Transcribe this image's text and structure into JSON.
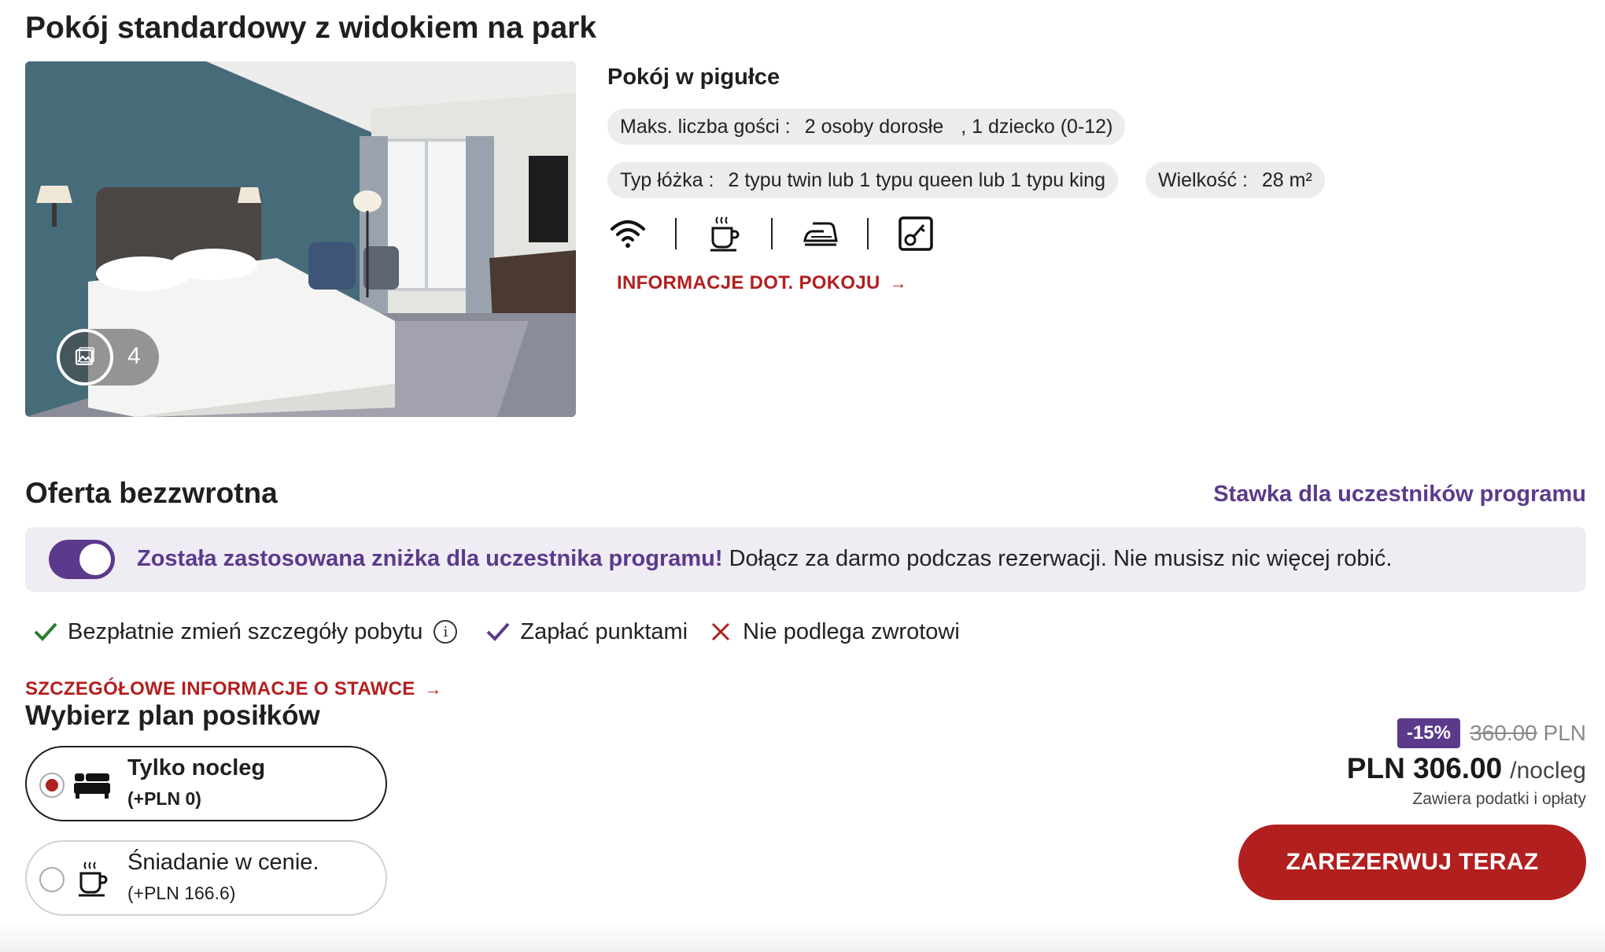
{
  "room": {
    "title": "Pokój standardowy z widokiem na park",
    "gallery_count": "4"
  },
  "summary": {
    "title": "Pokój w pigułce",
    "guests_label": "Maks. liczba gości :",
    "guests_value": "2 osoby dorosłe",
    "guests_child": ", 1 dziecko (0-12)",
    "bed_label": "Typ łóżka :",
    "bed_value": "2 typu twin lub 1 typu queen lub 1 typu king",
    "size_label": "Wielkość :",
    "size_value": "28 m²",
    "amenities": [
      "wifi-icon",
      "coffee-icon",
      "iron-icon",
      "key-card-icon"
    ],
    "info_link": "INFORMACJE DOT. POKOJU"
  },
  "offer": {
    "title": "Oferta bezzwrotna",
    "member_rate_link": "Stawka dla uczestników programu",
    "banner_strong": "Została zastosowana zniżka dla uczestnika programu!",
    "banner_text": " Dołącz za darmo podczas rezerwacji. Nie musisz nic więcej robić.",
    "features": [
      {
        "text": "Bezpłatnie zmień szczegóły pobytu",
        "icon": "check-icon"
      },
      {
        "text": "Zapłać punktami",
        "icon": "check-icon"
      },
      {
        "text": "Nie podlega zwrotowi",
        "icon": "cross-icon"
      }
    ],
    "info_icon_glyph": "i",
    "rate_details_link": "SZCZEGÓŁOWE INFORMACJE O STAWCE"
  },
  "meal_plan": {
    "title": "Wybierz plan posiłków",
    "options": [
      {
        "name": "Tylko nocleg",
        "price": "(+PLN 0)",
        "icon": "bed-icon",
        "selected": true
      },
      {
        "name": "Śniadanie w cenie.",
        "price": "(+PLN 166.6)",
        "icon": "coffee-icon",
        "selected": false
      }
    ]
  },
  "pricing": {
    "discount": "-15%",
    "old_price_value": "360.00",
    "old_price_currency": "PLN",
    "price": "PLN 306.00",
    "unit": "/nocleg",
    "note": "Zawiera podatki i opłaty",
    "book_label": "ZAREZERWUJ TERAZ"
  },
  "colors": {
    "accent_red": "#b21f1f",
    "accent_purple": "#5b3a8c",
    "banner_bg": "#efecf4",
    "check_green": "#2e7d32"
  }
}
